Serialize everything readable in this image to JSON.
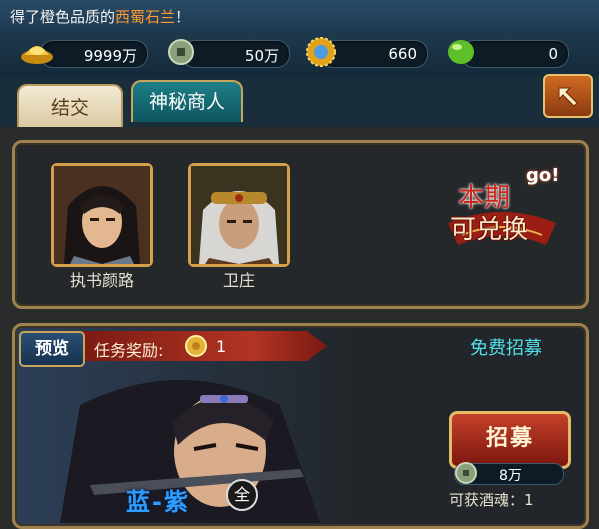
{
  "notice": {
    "prefix": "得了橙色品质的",
    "item": "西蜀石兰",
    "suffix": "！"
  },
  "resources": [
    {
      "icon": "gold-ingot-icon",
      "value": "9999万"
    },
    {
      "icon": "coin-icon",
      "value": "50万"
    },
    {
      "icon": "sun-medal-icon",
      "value": "660"
    },
    {
      "icon": "green-gem-icon",
      "value": "0"
    }
  ],
  "tabs": [
    {
      "label": "结交"
    },
    {
      "label": "神秘商人"
    }
  ],
  "heroes": [
    {
      "name": "执书颜路"
    },
    {
      "name": "卫庄"
    }
  ],
  "promo": {
    "line1": "本期",
    "line2": "可兑换",
    "badge": "go!"
  },
  "recruit": {
    "preview_label": "预览",
    "reward_label": "任务奖励:",
    "reward_value": "1",
    "free_label": "免费招募",
    "button_label": "招募",
    "cost_value": "8万",
    "soul_label": "可获酒魂：1",
    "quality_text": "蓝-紫",
    "quality_badge": "全"
  },
  "colors": {
    "highlight": "#ff9a2e",
    "free_text": "#4fe0e8",
    "frame_gold": "#9f8150"
  }
}
